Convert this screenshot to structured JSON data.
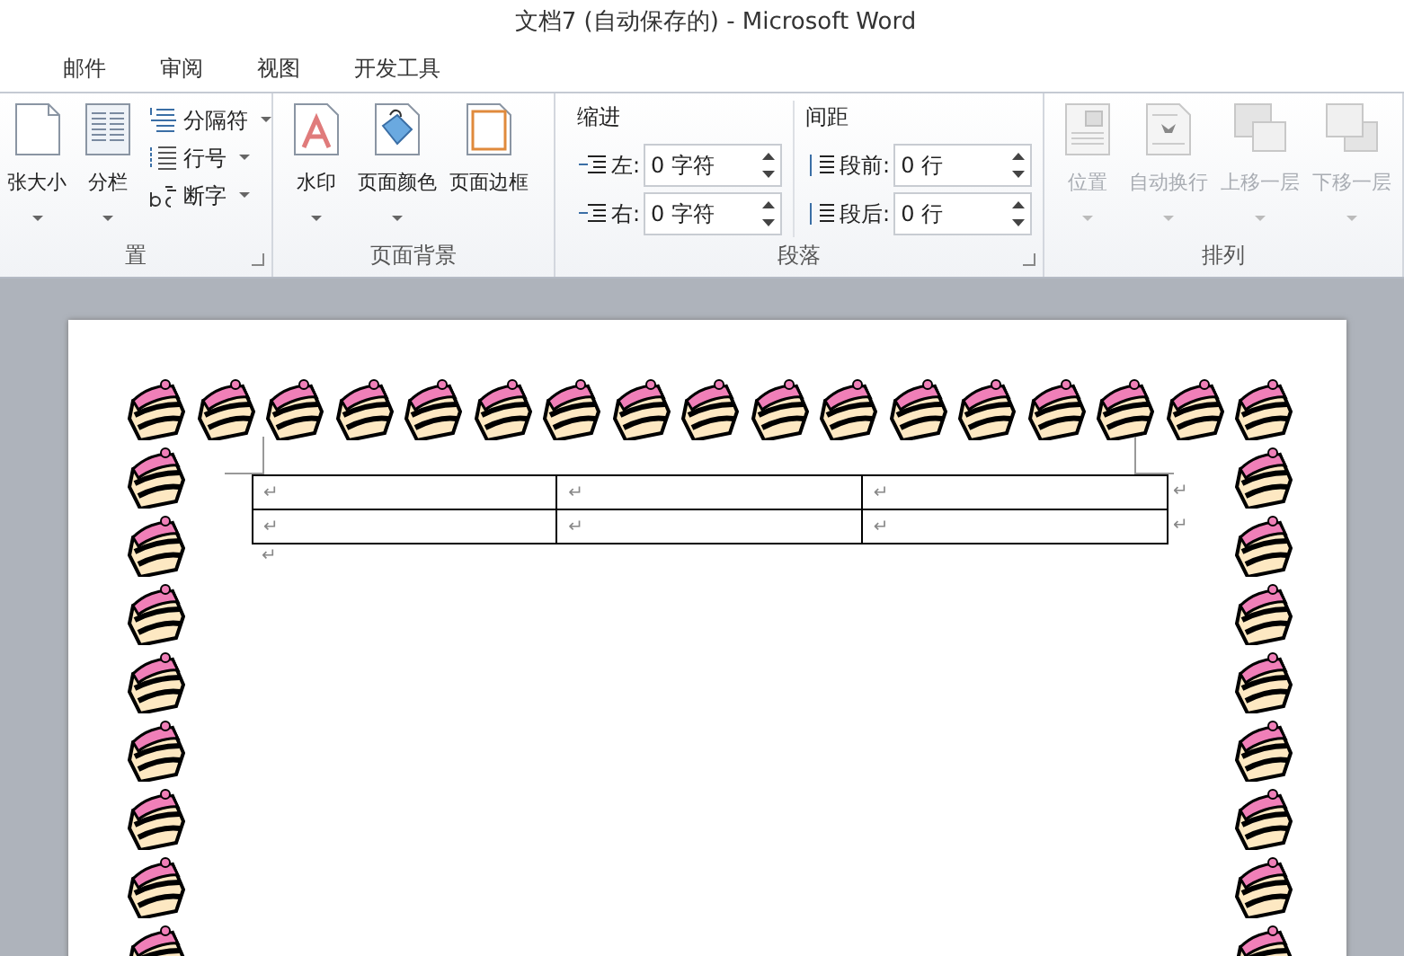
{
  "window": {
    "title": "文档7 (自动保存的)  -  Microsoft Word"
  },
  "tabs": [
    {
      "label": "邮件"
    },
    {
      "label": "审阅"
    },
    {
      "label": "视图"
    },
    {
      "label": "开发工具"
    }
  ],
  "ribbon": {
    "groups": [
      {
        "kind": "buttons",
        "label": "置",
        "dialog_launcher": true,
        "items": [
          {
            "kind": "paper",
            "label": "张大小",
            "dropdown": true,
            "disabled": false
          },
          {
            "kind": "columns",
            "label": "分栏",
            "dropdown": true,
            "disabled": false
          }
        ],
        "small_items": [
          {
            "kind": "breaks",
            "label": "分隔符",
            "dropdown": true
          },
          {
            "kind": "lines",
            "label": "行号",
            "dropdown": true
          },
          {
            "kind": "hyphen",
            "label": "断字",
            "dropdown": true
          }
        ]
      },
      {
        "kind": "buttons",
        "label": "页面背景",
        "dialog_launcher": false,
        "items": [
          {
            "kind": "watermark",
            "label": "水印",
            "dropdown": true,
            "disabled": false
          },
          {
            "kind": "fill",
            "label": "页面颜色",
            "dropdown": true,
            "disabled": false
          },
          {
            "kind": "border",
            "label": "页面边框",
            "dropdown": false,
            "disabled": false
          }
        ]
      },
      {
        "kind": "fields",
        "label": "段落",
        "dialog_launcher": true,
        "sections": [
          {
            "title": "缩进",
            "fields": [
              {
                "kind": "left",
                "label": "左:",
                "value": "0 字符"
              },
              {
                "kind": "right",
                "label": "右:",
                "value": "0 字符"
              }
            ]
          },
          {
            "title": "间距",
            "fields": [
              {
                "kind": "before",
                "label": "段前:",
                "value": "0 行"
              },
              {
                "kind": "after",
                "label": "段后:",
                "value": "0 行"
              }
            ]
          }
        ]
      },
      {
        "kind": "buttons",
        "label": "排列",
        "dialog_launcher": false,
        "items": [
          {
            "kind": "position",
            "label": "位置",
            "dropdown": true,
            "disabled": true
          },
          {
            "kind": "wrap",
            "label": "自动换行",
            "dropdown": true,
            "disabled": true
          },
          {
            "kind": "forward",
            "label": "上移一层",
            "dropdown": true,
            "disabled": true
          },
          {
            "kind": "backward",
            "label": "下移一层",
            "dropdown": true,
            "disabled": true
          }
        ]
      }
    ]
  },
  "document": {
    "table": {
      "rows": [
        {
          "cells": [
            "↵",
            "↵",
            "↵"
          ],
          "end_mark": "↵"
        },
        {
          "cells": [
            "↵",
            "↵",
            "↵"
          ],
          "end_mark": "↵"
        }
      ]
    },
    "paragraphs": [
      "↵"
    ]
  }
}
